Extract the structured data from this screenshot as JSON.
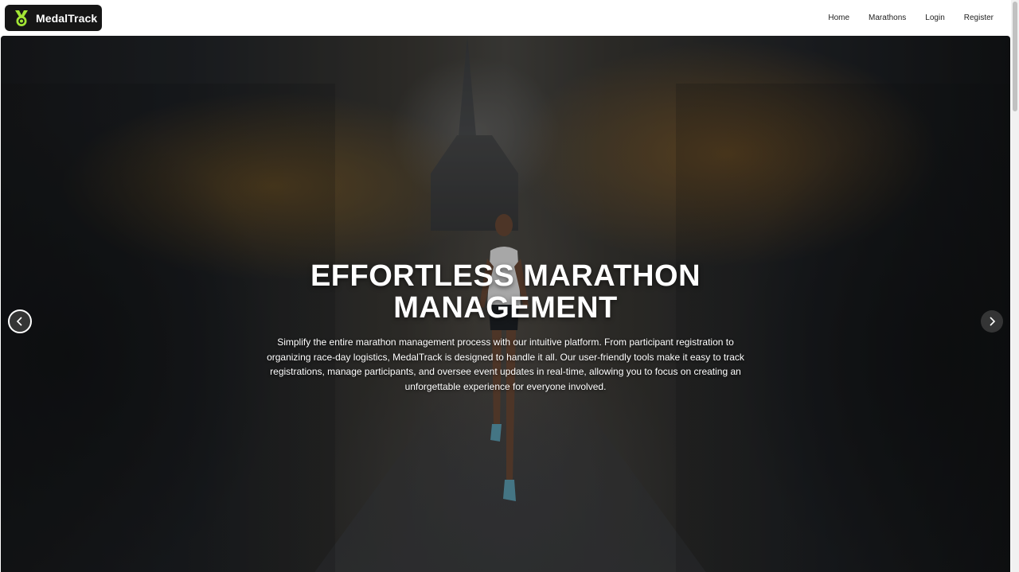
{
  "header": {
    "brand": "MedalTrack",
    "logo_icon": "medal-icon",
    "nav": [
      {
        "label": "Home"
      },
      {
        "label": "Marathons"
      },
      {
        "label": "Login"
      },
      {
        "label": "Register"
      }
    ]
  },
  "hero": {
    "title": "EFFORTLESS MARATHON MANAGEMENT",
    "description": "Simplify the entire marathon management process with our intuitive platform. From participant registration to organizing race-day logistics, MedalTrack is designed to handle it all. Our user-friendly tools make it easy to track registrations, manage participants, and oversee event updates in real-time, allowing you to focus on creating an unforgettable experience for everyone involved.",
    "image_alt_icon": "runner-photo",
    "prev_icon": "chevron-left-icon",
    "next_icon": "chevron-right-icon"
  },
  "colors": {
    "logo_bg": "#161616",
    "logo_accent": "#a3e635",
    "text_on_hero": "#ffffff",
    "nav_text": "#222222"
  }
}
